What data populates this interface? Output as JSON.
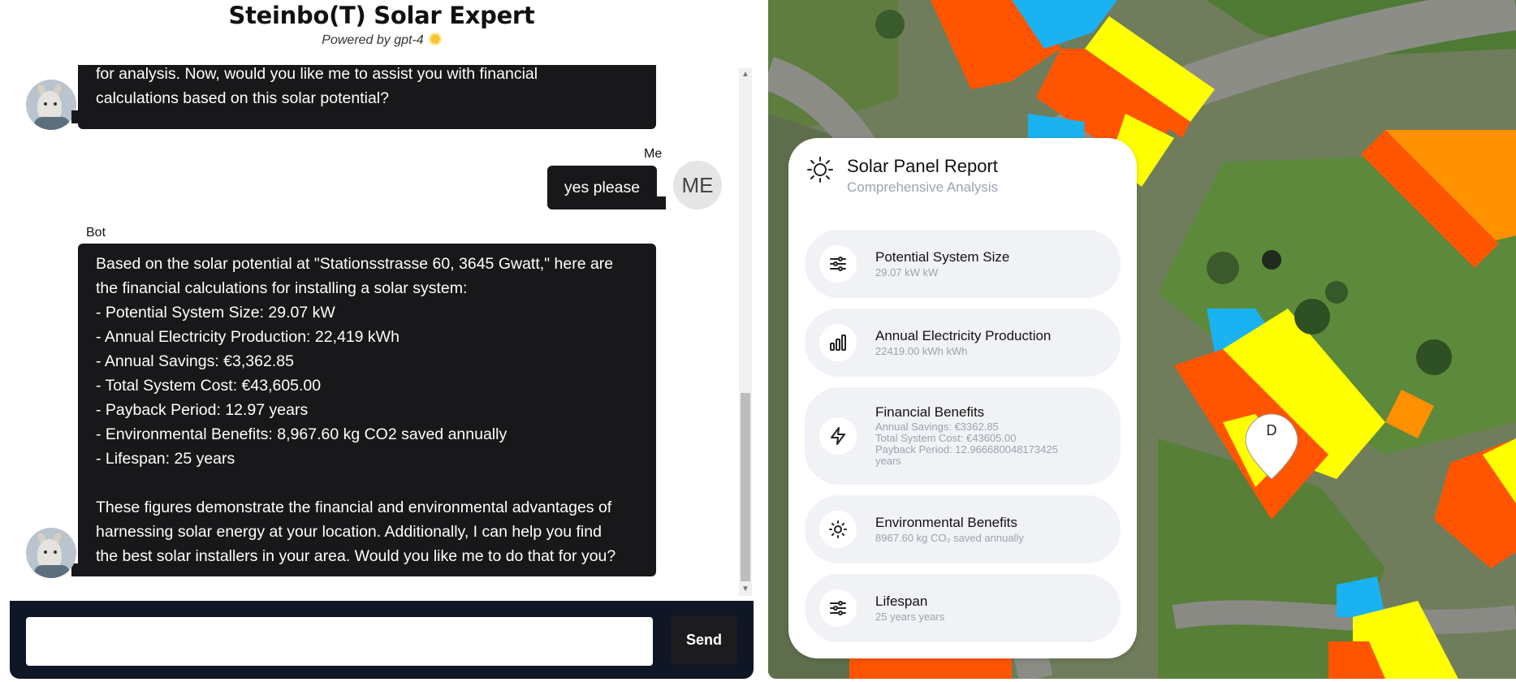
{
  "header": {
    "title": "Steinbo(T) Solar Expert",
    "subtitle": "Powered by gpt-4"
  },
  "chat": {
    "messages": [
      {
        "sender": "Bot",
        "lines": [
          "for analysis. Now, would you like me to assist you with financial",
          "calculations based on this solar potential?"
        ]
      },
      {
        "sender": "Me",
        "avatar_text": "ME",
        "lines": [
          "yes please"
        ]
      },
      {
        "sender": "Bot",
        "lines": [
          "Based on the solar potential at \"Stationsstrasse 60, 3645 Gwatt,\" here are",
          "the financial calculations for installing a solar system:",
          "- Potential System Size: 29.07 kW",
          "- Annual Electricity Production: 22,419 kWh",
          "- Annual Savings: €3,362.85",
          "- Total System Cost: €43,605.00",
          "- Payback Period: 12.97 years",
          "- Environmental Benefits: 8,967.60 kg CO2 saved annually",
          "- Lifespan: 25 years",
          "",
          "These figures demonstrate the financial and environmental advantages of",
          "harnessing solar energy at your location. Additionally, I can help you find",
          "the best solar installers in your area. Would you like me to do that for you?"
        ]
      }
    ]
  },
  "input": {
    "value": "",
    "send_label": "Send"
  },
  "report": {
    "title": "Solar Panel Report",
    "subtitle": "Comprehensive Analysis",
    "cards": [
      {
        "icon": "sliders-icon",
        "title": "Potential System Size",
        "lines": [
          "29.07 kW kW"
        ]
      },
      {
        "icon": "bar-chart-icon",
        "title": "Annual Electricity Production",
        "lines": [
          "22419.00 kWh kWh"
        ]
      },
      {
        "icon": "lightning-icon",
        "title": "Financial Benefits",
        "lines": [
          "Annual Savings: €3362.85",
          "Total System Cost: €43605.00",
          "Payback Period: 12.966680048173425",
          "years"
        ]
      },
      {
        "icon": "sun-icon",
        "title": "Environmental Benefits",
        "lines": [
          "8967.60 kg CO₂ saved annually"
        ]
      },
      {
        "icon": "sliders-icon",
        "title": "Lifespan",
        "lines": [
          "25 years years"
        ]
      }
    ]
  },
  "map": {
    "marker_label": "D"
  }
}
